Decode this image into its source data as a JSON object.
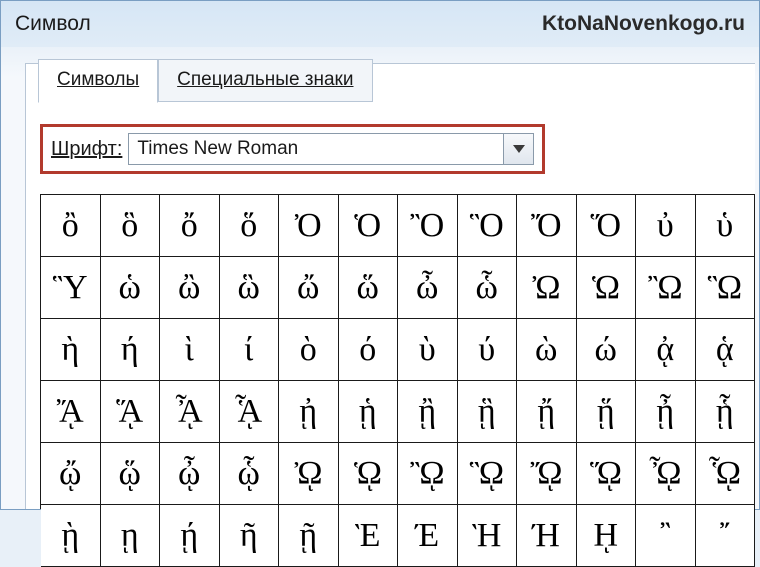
{
  "window": {
    "title": "Символ",
    "watermark": "KtoNaNovenkogo.ru"
  },
  "tabs": {
    "symbols": "Символы",
    "special": "Специальные знаки"
  },
  "font": {
    "label_prefix": "Ш",
    "label_rest": "рифт:",
    "value": "Times New Roman"
  },
  "grid": {
    "rows": [
      [
        "ὂ",
        "ὃ",
        "ὄ",
        "ὅ",
        "Ὀ",
        "Ὁ",
        "Ὂ",
        "Ὃ",
        "Ὄ",
        "Ὅ",
        "ὐ",
        "ὑ"
      ],
      [
        "Ὓ",
        "ὡ",
        "ὢ",
        "ὣ",
        "ὤ",
        "ὥ",
        "ὦ",
        "ὧ",
        "Ὠ",
        "Ὡ",
        "Ὢ",
        "Ὣ"
      ],
      [
        "ὴ",
        "ή",
        "ὶ",
        "ί",
        "ὸ",
        "ό",
        "ὺ",
        "ύ",
        "ὼ",
        "ώ",
        "ᾀ",
        "ᾁ"
      ],
      [
        "ᾌ",
        "ᾍ",
        "ᾎ",
        "ᾏ",
        "ᾐ",
        "ᾑ",
        "ᾒ",
        "ᾓ",
        "ᾔ",
        "ᾕ",
        "ᾖ",
        "ᾗ"
      ],
      [
        "ᾤ",
        "ᾥ",
        "ᾦ",
        "ᾧ",
        "ᾨ",
        "ᾩ",
        "ᾪ",
        "ᾫ",
        "ᾬ",
        "ᾭ",
        "ᾮ",
        "ᾯ"
      ],
      [
        "ῂ",
        "ῃ",
        "ῄ",
        "ῆ",
        "ῇ",
        "Ὲ",
        "Έ",
        "Ὴ",
        "Ή",
        "ῌ",
        "῍",
        "῎"
      ]
    ]
  }
}
